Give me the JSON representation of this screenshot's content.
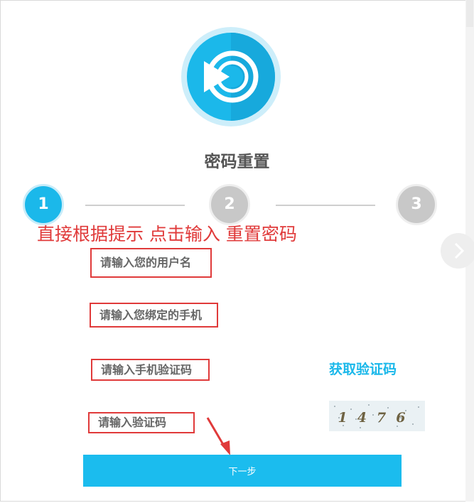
{
  "page_title": "密码重置",
  "instruction": "直接根据提示 点击输入 重置密码",
  "steps": [
    {
      "label": "1",
      "state": "active"
    },
    {
      "label": "2",
      "state": "inactive"
    },
    {
      "label": "3",
      "state": "inactive"
    }
  ],
  "form": {
    "username_placeholder": "请输入您的用户名",
    "phone_placeholder": "请输入您绑定的手机",
    "sms_code_placeholder": "请输入手机验证码",
    "captcha_placeholder": "请输入验证码",
    "get_code_label": "获取验证码",
    "captcha_text": "1476",
    "submit_label": "下一步"
  },
  "icons": {
    "logo": "play-logo-icon",
    "next": "chevron-right-icon",
    "annotation": "red-arrow-icon"
  },
  "colors": {
    "accent": "#1bb8ea",
    "annotation_red": "#e03a3a",
    "step_inactive": "#c8c8c8"
  }
}
